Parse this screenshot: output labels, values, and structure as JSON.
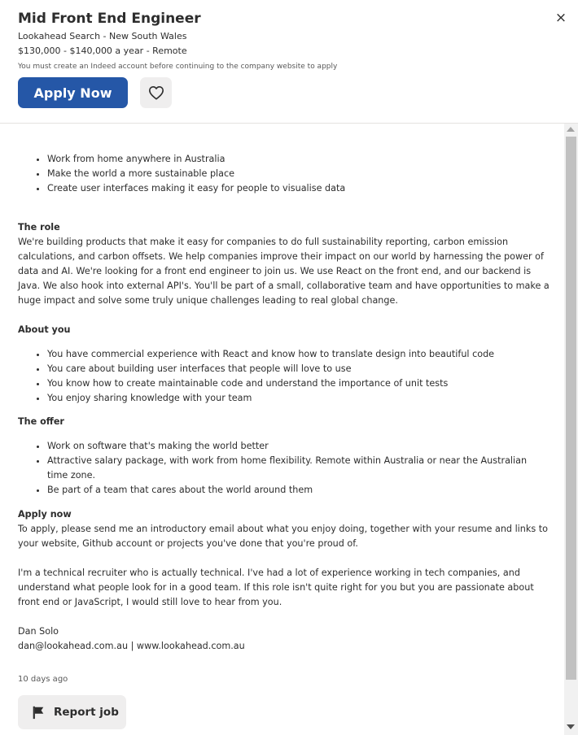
{
  "job": {
    "title": "Mid Front End Engineer",
    "company_location": "Lookahead Search - New South Wales",
    "salary_remote": "$130,000 - $140,000 a year - Remote",
    "notice": "You must create an Indeed account before continuing to the company website to apply",
    "apply_label": "Apply Now",
    "close_glyph": "×"
  },
  "description": {
    "perks": [
      "Work from home anywhere in Australia",
      "Make the world a more sustainable place",
      "Create user interfaces making it easy for people to visualise data"
    ],
    "role_heading": "The role",
    "role_text": "We're building products that make it easy for companies to do full sustainability reporting, carbon emission calculations, and carbon offsets. We help companies improve their impact on our world by harnessing the power of data and AI. We're looking for a front end engineer to join us. We use React on the front end, and our backend is Java. We also hook into external API's. You'll be part of a small, collaborative team and have opportunities to make a huge impact and solve some truly unique challenges leading to real global change.",
    "about_heading": "About you",
    "about_items": [
      "You have commercial experience with React and know how to translate design into beautiful code",
      "You care about building user interfaces that people will love to use",
      "You know how to create maintainable code and understand the importance of unit tests",
      "You enjoy sharing knowledge with your team"
    ],
    "offer_heading": "The offer",
    "offer_items": [
      "Work on software that's making the world better",
      "Attractive salary package, with work from home flexibility. Remote within Australia or near the Australian time zone.",
      "Be part of a team that cares about the world around them"
    ],
    "apply_heading": "Apply now",
    "apply_text": "To apply, please send me an introductory email about what you enjoy doing, together with your resume and links to your website, Github account or projects you've done that you're proud of.",
    "recruiter_text": "I'm a technical recruiter who is actually technical. I've had a lot of experience working in tech companies, and understand what people look for in a good team. If this role isn't quite right for you but you are passionate about front end or JavaScript, I would still love to hear from you.",
    "signature_name": "Dan Solo",
    "signature_contact": "dan@lookahead.com.au | www.lookahead.com.au",
    "posted": "10 days ago",
    "report_label": "Report job"
  },
  "icons": {
    "save": "heart-icon",
    "close": "close-icon",
    "report": "flag-icon"
  },
  "colors": {
    "primary": "#2557a7",
    "text": "#2d2d2d",
    "muted": "#595959",
    "button_bg": "#efeeee"
  }
}
